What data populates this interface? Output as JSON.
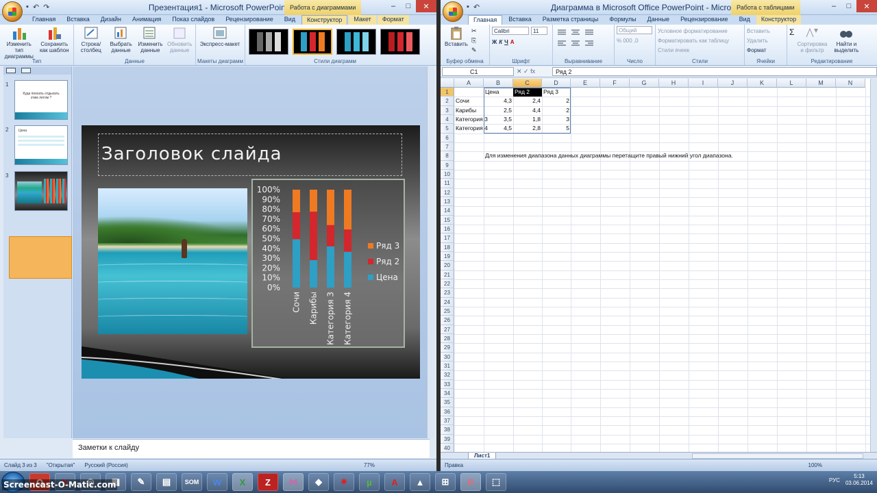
{
  "ppt": {
    "title": "Презентация1 - Microsoft PowerPoint",
    "context_tab": "Работа с диаграммами",
    "tabs": [
      "Главная",
      "Вставка",
      "Дизайн",
      "Анимация",
      "Показ слайдов",
      "Рецензирование",
      "Вид",
      "Конструктор",
      "Макет",
      "Формат"
    ],
    "active_tab": "Конструктор",
    "ribbon": {
      "type_group": "Тип",
      "change_type": "Изменить тип диаграммы",
      "save_template": "Сохранить как шаблон",
      "data_group": "Данные",
      "row_col": "Строка/столбец",
      "select_data": "Выбрать данные",
      "edit_data": "Изменить данные",
      "refresh_data": "Обновить данные",
      "layouts_group": "Макеты диаграмм",
      "express_layout": "Экспресс-макет",
      "styles_group": "Стили диаграмм"
    },
    "thumbs": [
      {
        "num": "1",
        "text": "Куда поехать отдыхать этим летом ?"
      },
      {
        "num": "2",
        "text": "Цена"
      },
      {
        "num": "3",
        "text": ""
      }
    ],
    "slide_title": "Заголовок слайда",
    "notes_placeholder": "Заметки к слайду",
    "status": {
      "slide": "Слайд 3 из 3",
      "theme": "\"Открытая\"",
      "lang": "Русский (Россия)",
      "zoom": "77%"
    }
  },
  "chart_data": {
    "type": "bar",
    "stacked": "100%",
    "categories": [
      "Сочи",
      "Карибы",
      "Категория 3",
      "Категория 4"
    ],
    "series": [
      {
        "name": "Цена",
        "values": [
          4.3,
          2.5,
          3.5,
          4.5
        ],
        "color": "#2e9fc5"
      },
      {
        "name": "Ряд 2",
        "values": [
          2.4,
          4.4,
          1.8,
          2.8
        ],
        "color": "#d4262d"
      },
      {
        "name": "Ряд 3",
        "values": [
          2,
          2,
          3,
          5
        ],
        "color": "#ef7a22"
      }
    ],
    "y_ticks": [
      "0%",
      "10%",
      "20%",
      "30%",
      "40%",
      "50%",
      "60%",
      "70%",
      "80%",
      "90%",
      "100%"
    ],
    "legend_position": "right",
    "legend_order": [
      "Ряд 3",
      "Ряд 2",
      "Цена"
    ]
  },
  "excel": {
    "title": "Диаграмма в Microsoft Office PowerPoint - Microsoft Excel",
    "context_tab": "Работа с таблицами",
    "tabs": [
      "Главная",
      "Вставка",
      "Разметка страницы",
      "Формулы",
      "Данные",
      "Рецензирование",
      "Вид",
      "Конструктор"
    ],
    "active_tab": "Главная",
    "ribbon": {
      "paste": "Вставить",
      "clipboard": "Буфер обмена",
      "font_name": "Calibri",
      "font_size": "11",
      "font_group": "Шрифт",
      "align_group": "Выравнивание",
      "number_format": "Общий",
      "number_group": "Число",
      "cond_format": "Условное форматирование",
      "format_table": "Форматировать как таблицу",
      "cell_styles": "Стили ячеек",
      "styles_group": "Стили",
      "insert": "Вставить",
      "delete": "Удалить",
      "format": "Формат",
      "cells_group": "Ячейки",
      "sort_filter": "Сортировка и фильтр",
      "find_select": "Найти и выделить",
      "edit_group": "Редактирование"
    },
    "namebox": "C1",
    "formula": "Ряд 2",
    "columns": [
      "A",
      "B",
      "C",
      "D",
      "E",
      "F",
      "G",
      "H",
      "I",
      "J",
      "K",
      "L",
      "M",
      "N"
    ],
    "rows": [
      [
        "",
        "Цена",
        "Ряд 2",
        "Ряд 3"
      ],
      [
        "Сочи",
        "4,3",
        "2,4",
        "2"
      ],
      [
        "Карибы",
        "2,5",
        "4,4",
        "2"
      ],
      [
        "Категория 3",
        "3,5",
        "1,8",
        "3"
      ],
      [
        "Категория 4",
        "4,5",
        "2,8",
        "5"
      ]
    ],
    "note": "Для изменения диапазона данных диаграммы перетащите правый нижний угол диапазона.",
    "sheet_tab": "Лист1",
    "status": "Правка",
    "zoom": "100%"
  },
  "taskbar": {
    "watermark": "Screencast-O-Matic.com",
    "lang": "РУС",
    "time": "5:13",
    "date": "03.06.2014"
  }
}
